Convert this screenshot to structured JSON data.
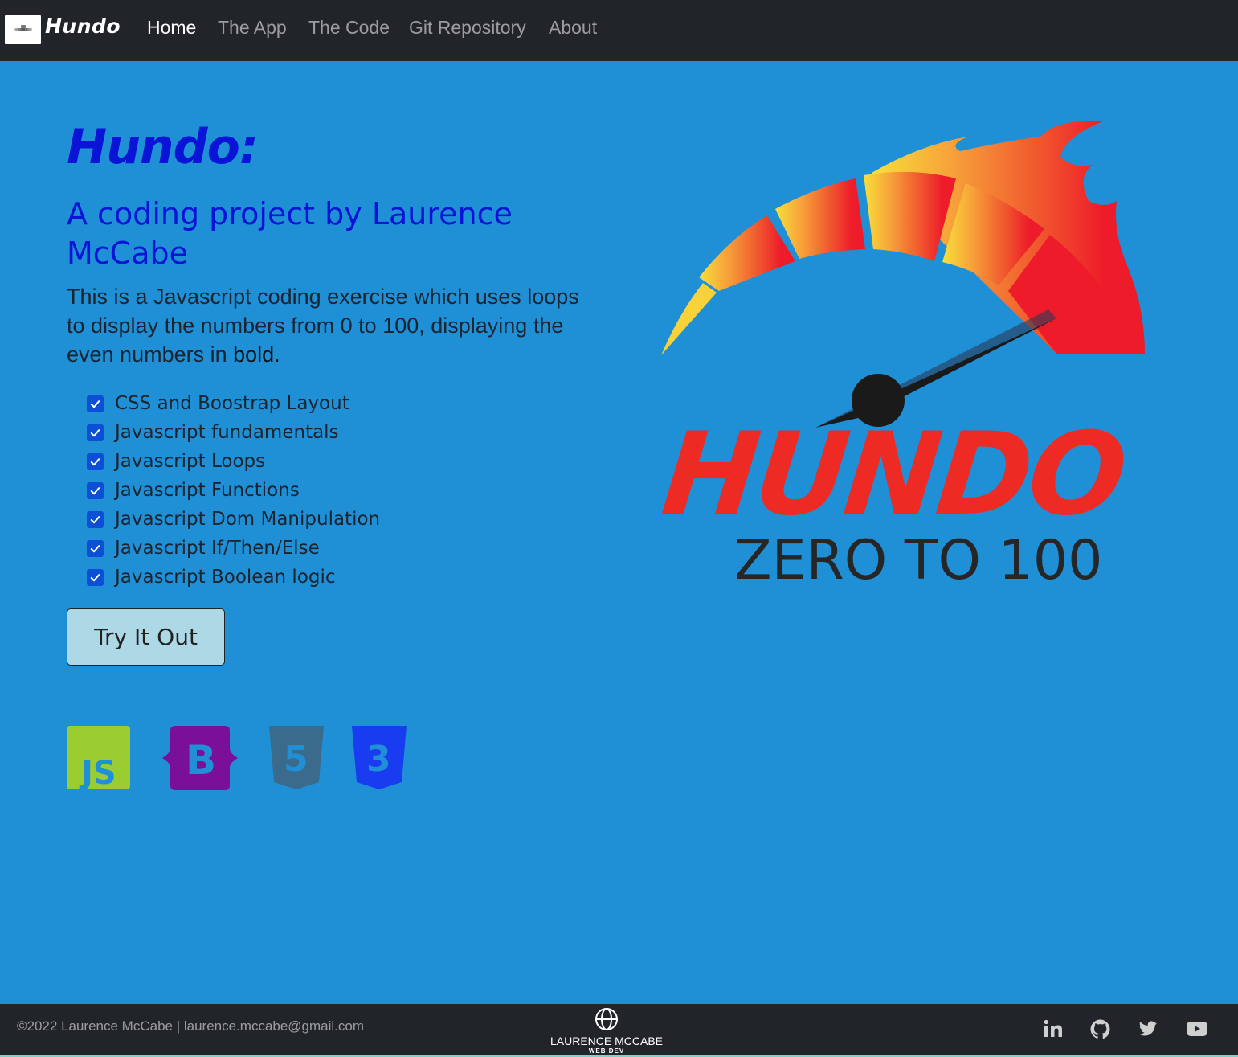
{
  "navbar": {
    "brand": "Hundo",
    "links": [
      {
        "label": "Home",
        "active": true
      },
      {
        "label": "The App",
        "active": false
      },
      {
        "label": "The Code",
        "active": false
      },
      {
        "label": "Git Repository",
        "active": false
      },
      {
        "label": "About",
        "active": false
      }
    ]
  },
  "hero": {
    "title": "Hundo:",
    "subtitle": "A coding project by Laurence McCabe",
    "description_text": "This is a Javascript coding exercise which uses loops to display the numbers from 0 to 100, displaying the even numbers in ",
    "description_bold": "bold.",
    "features": [
      "CSS and Boostrap Layout",
      "Javascript fundamentals",
      "Javascript Loops",
      "Javascript Functions",
      "Javascript Dom Manipulation",
      "Javascript If/Then/Else",
      "Javascript Boolean logic"
    ],
    "button_label": "Try It Out"
  },
  "tech_icons": [
    {
      "name": "javascript-icon",
      "color": "#9acd32",
      "text": "JS"
    },
    {
      "name": "bootstrap-icon",
      "color": "#7a0f99",
      "text": "B"
    },
    {
      "name": "html5-icon",
      "color": "#3a6b8c",
      "text": "5"
    },
    {
      "name": "css3-icon",
      "color": "#1a3cf0",
      "text": "3"
    }
  ],
  "logo": {
    "word": "HUNDO",
    "tagline": "ZERO TO 100",
    "colors": {
      "red": "#ee2a24",
      "orange": "#f37c2a",
      "yellow": "#f7d23a",
      "dark": "#262626"
    }
  },
  "footer": {
    "copyright": "©2022 Laurence McCabe | laurence.mccabe@gmail.com",
    "brand_name": "LAURENCE MCCABE",
    "brand_sub": "WEB DEV",
    "social": [
      "linkedin-icon",
      "github-icon",
      "twitter-icon",
      "youtube-icon"
    ]
  },
  "colors": {
    "page_bg": "#1f8fd6",
    "navbar_bg": "#212529",
    "title_blue": "#0a14d6",
    "button_bg": "#add8e6"
  }
}
